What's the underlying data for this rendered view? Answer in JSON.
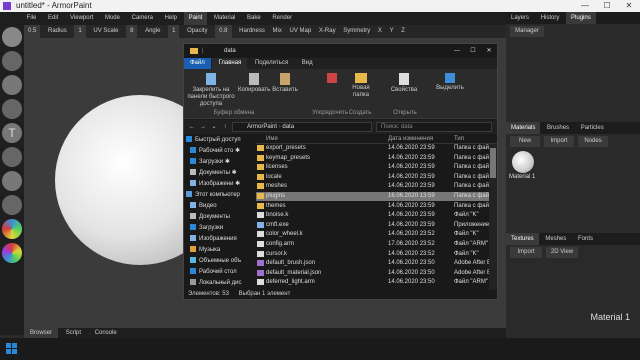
{
  "app": {
    "title": "untitled* - ArmorPaint",
    "win_min": "—",
    "win_max": "☐",
    "win_close": "✕"
  },
  "menubar": {
    "items": [
      "File",
      "Edit",
      "Viewport",
      "Mode",
      "Camera",
      "Help"
    ],
    "tabs": [
      "Paint",
      "Material",
      "Bake",
      "Render"
    ],
    "right_tabs": [
      "Layers",
      "History",
      "Plugins"
    ]
  },
  "toolbar": {
    "opacity0": "0.5",
    "radius_label": "Radius",
    "radius_val": "1",
    "uvscale_label": "UV Scale",
    "uvscale_val": "8",
    "angle_label": "Angle",
    "angle_val": "1",
    "opacity_label": "Opacity",
    "opacity_val": "0.8",
    "hardness_label": "Hardness",
    "mix_label": "Mix",
    "uvmap": "UV Map",
    "xray": "X-Ray",
    "symmetry": "Symmetry",
    "x": "X",
    "y": "Y",
    "z": "Z",
    "sub": [
      "Input",
      "Texture",
      "Color",
      "Vector",
      "Converter",
      "ColorRGB",
      "Sense"
    ]
  },
  "right_panel": {
    "manager": "Manager",
    "mat_tabs": [
      "Materials",
      "Brushes",
      "Particles"
    ],
    "mat_buttons": [
      "New",
      "Import",
      "Nodes"
    ],
    "material_name": "Material 1",
    "tex_tabs": [
      "Textures",
      "Meshes",
      "Fonts"
    ],
    "tex_buttons": [
      "Import",
      "2D View"
    ]
  },
  "viewport_label": "Material 1",
  "bottom_tabs": [
    "Browser",
    "Script",
    "Console"
  ],
  "explorer": {
    "title": "data",
    "tabs": [
      "Файл",
      "Главная",
      "Поделиться",
      "Вид"
    ],
    "ribbon": {
      "pin": "Закрепить на панели быстрого доступа",
      "copy": "Копировать",
      "paste": "Вставить",
      "new_folder": "Новая папка",
      "properties": "Свойства",
      "select": "Выделить",
      "groups": [
        "Буфер обмена",
        "Упорядочить",
        "Создать",
        "Открыть"
      ]
    },
    "address": [
      "ArmorPaint",
      "data"
    ],
    "search_placeholder": "Поиск: data",
    "columns": [
      "Имя",
      "Дата изменения",
      "Тип"
    ],
    "nav": [
      {
        "label": "Быстрый доступ",
        "color": "#2b88d8"
      },
      {
        "label": "Рабочий сто ✱",
        "color": "#2b88d8"
      },
      {
        "label": "Загрузки ✱",
        "color": "#2b88d8"
      },
      {
        "label": "Документы ✱",
        "color": "#bbbbbb"
      },
      {
        "label": "Изображени ✱",
        "color": "#7fb2e5"
      },
      {
        "label": "Этот компьютер",
        "color": "#5a9bd5"
      },
      {
        "label": "Видео",
        "color": "#7fb2e5"
      },
      {
        "label": "Документы",
        "color": "#bbbbbb"
      },
      {
        "label": "Загрузки",
        "color": "#2b88d8"
      },
      {
        "label": "Изображения",
        "color": "#7fb2e5"
      },
      {
        "label": "Музыка",
        "color": "#e0a03a"
      },
      {
        "label": "Объемные объ",
        "color": "#5ab5e0"
      },
      {
        "label": "Рабочий стол",
        "color": "#2b88d8"
      },
      {
        "label": "Локальный дис",
        "color": "#999999"
      }
    ],
    "files": [
      {
        "name": "export_presets",
        "date": "14.06.2020 23:59",
        "type": "Папка с файл",
        "icon": "folder"
      },
      {
        "name": "keymap_presets",
        "date": "14.06.2020 23:59",
        "type": "Папка с файл",
        "icon": "folder"
      },
      {
        "name": "licenses",
        "date": "14.06.2020 23:59",
        "type": "Папка с файл",
        "icon": "folder"
      },
      {
        "name": "locale",
        "date": "14.06.2020 23:59",
        "type": "Папка с файл",
        "icon": "folder"
      },
      {
        "name": "meshes",
        "date": "14.06.2020 23:59",
        "type": "Папка с файл",
        "icon": "folder"
      },
      {
        "name": "plugins",
        "date": "16.06.2020 13:59",
        "type": "Папка с файл",
        "icon": "folder"
      },
      {
        "name": "themes",
        "date": "14.06.2020 23:59",
        "type": "Папка с файл",
        "icon": "folder"
      },
      {
        "name": "bnoise.k",
        "date": "14.06.2020 23:59",
        "type": "Файл \"K\"",
        "icon": "file"
      },
      {
        "name": "cmft.exe",
        "date": "14.06.2020 23:59",
        "type": "Приложение",
        "icon": "exe"
      },
      {
        "name": "color_wheel.k",
        "date": "14.06.2020 23:52",
        "type": "Файл \"K\"",
        "icon": "file"
      },
      {
        "name": "config.arm",
        "date": "17.06.2020 23:52",
        "type": "Файл \"ARM\"",
        "icon": "file"
      },
      {
        "name": "cursor.k",
        "date": "14.06.2020 23:52",
        "type": "Файл \"K\"",
        "icon": "file"
      },
      {
        "name": "default_brush.json",
        "date": "14.06.2020 23:50",
        "type": "Adobe After Eff",
        "icon": "json"
      },
      {
        "name": "default_material.json",
        "date": "14.06.2020 23:50",
        "type": "Adobe After Eff",
        "icon": "json"
      },
      {
        "name": "deferred_light.arm",
        "date": "14.06.2020 23:50",
        "type": "Файл \"ARM\"",
        "icon": "file"
      }
    ],
    "highlight_index": 5,
    "status": {
      "count": "Элементов: 53",
      "selected": "Выбран 1 элемент"
    }
  }
}
